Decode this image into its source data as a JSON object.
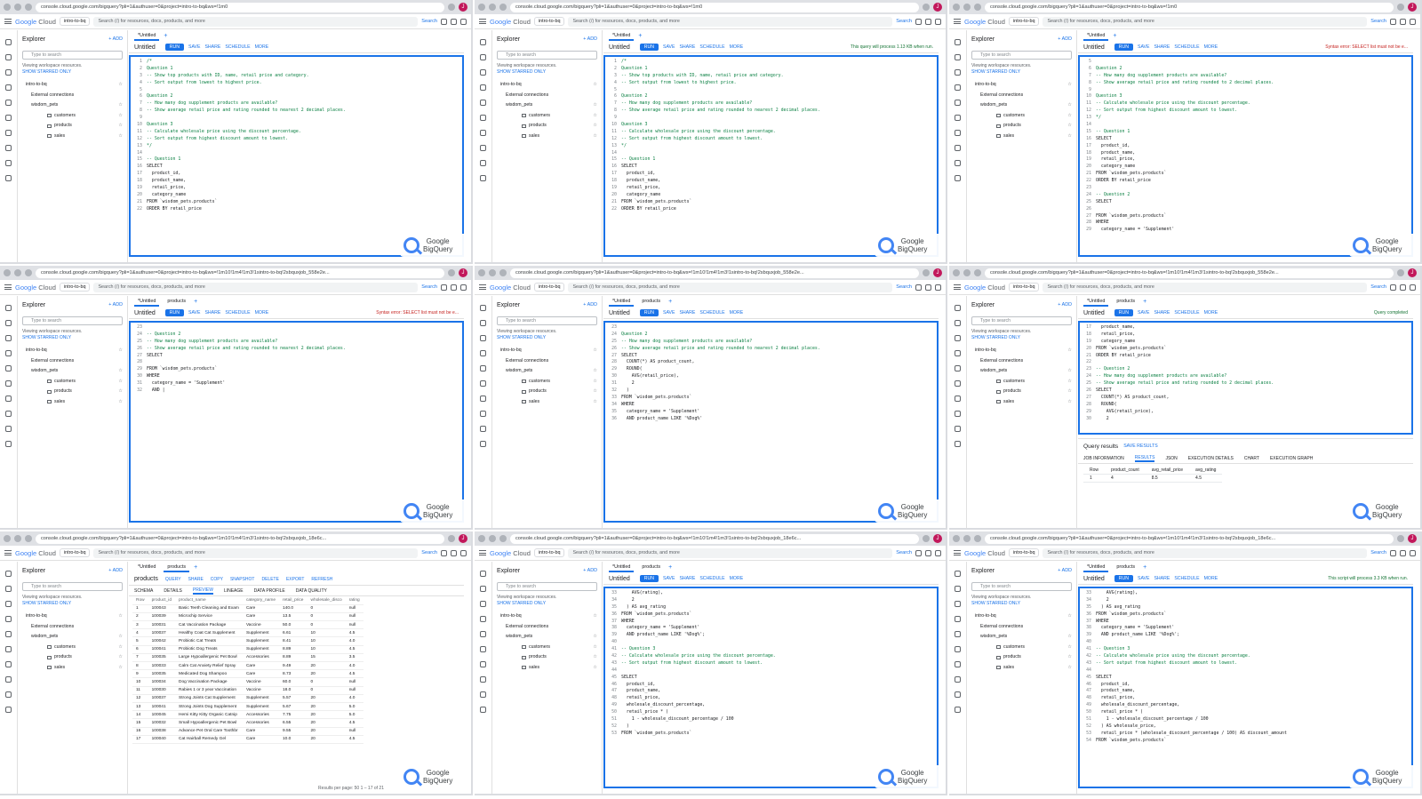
{
  "browser": {
    "url_top": "console.cloud.google.com/bigquery?pli=1&authuser=0&project=intro-to-bq&ws=!1m0",
    "url_mid": "console.cloud.google.com/bigquery?pli=1&authuser=0&project=intro-to-bq&ws=!1m10!1m4!1m3!1sintro-to-bq!2sbquxjob_558e2e...",
    "url_bot": "console.cloud.google.com/bigquery?pli=1&authuser=0&project=intro-to-bq&ws=!1m10!1m4!1m3!1sintro-to-bq!2sbquxjob_18e6c...",
    "avatar": "J"
  },
  "gcp": {
    "logo_google": "Google",
    "logo_cloud": " Cloud",
    "project": "intro-to-bq",
    "search_placeholder": "Search (/) for resources, docs, products, and more",
    "search_button": "Search"
  },
  "explorer": {
    "title": "Explorer",
    "add": "+ ADD",
    "filter_placeholder": "Type to search",
    "note_1": "Viewing workspace resources.",
    "note_2": "SHOW STARRED ONLY",
    "tree": [
      "intro-to-bq",
      "External connections",
      "wisdom_pets",
      "customers",
      "products",
      "sales"
    ]
  },
  "workspace": {
    "tab_untitled": "*Untitled",
    "tab_products": "products",
    "title": "Untitled",
    "run": "RUN",
    "save": "SAVE",
    "share": "SHARE",
    "schedule": "SCHEDULE",
    "more": "MORE",
    "status_ok": "This query will process 1.13 KB when run.",
    "status_err": "Syntax error: SELECT list must not be e...",
    "status_done": "Query completed",
    "status_script": "This script will process 3.3 KB when run.",
    "results_label": "Query results",
    "save_results": "SAVE RESULTS"
  },
  "watermark": {
    "line1": "Google",
    "line2": "BigQuery"
  },
  "code_a": [
    "/*",
    "Question 1",
    "-- Show top products with ID, name, retail price and category.",
    "-- Sort output from lowest to highest price.",
    "",
    "Question 2",
    "-- How many dog supplement products are available?",
    "-- Show average retail price and rating rounded to nearest 2 decimal places.",
    "",
    "Question 3",
    "-- Calculate wholesale price using the discount percentage.",
    "-- Sort output from highest discount amount to lowest.",
    "*/",
    "",
    "-- Question 1",
    "SELECT",
    "  product_id,",
    "  product_name,",
    "  retail_price,",
    "  category_name",
    "FROM `wisdom_pets.products`",
    "ORDER BY retail_price"
  ],
  "code_c": [
    "",
    "Question 2",
    "-- How many dog supplement products are available?",
    "-- Show average retail price and rating rounded to 2 decimal places.",
    "",
    "Question 3",
    "-- Calculate wholesale price using the discount percentage.",
    "-- Sort output from highest discount amount to lowest.",
    "*/",
    "",
    "-- Question 1",
    "SELECT",
    "  product_id,",
    "  product_name,",
    "  retail_price,",
    "  category_name",
    "FROM `wisdom_pets.products`",
    "ORDER BY retail_price",
    "",
    "-- Question 2",
    "SELECT",
    "",
    "FROM `wisdom_pets.products`",
    "WHERE",
    "  category_name = 'Supplement'"
  ],
  "code_d": [
    "",
    "-- Question 2",
    "-- How many dog supplement products are available?",
    "-- Show average retail price and rating rounded to nearest 2 decimal places.",
    "SELECT",
    "",
    "FROM `wisdom_pets.products`",
    "WHERE",
    "  category_name = 'Supplement'",
    "  AND |"
  ],
  "code_e": [
    "",
    "Question 2",
    "-- How many dog supplement products are available?",
    "-- Show average retail price and rating rounded to nearest 2 decimal places.",
    "SELECT",
    "  COUNT(*) AS product_count,",
    "  ROUND(",
    "    AVG(retail_price),",
    "    2",
    "  )",
    "FROM `wisdom_pets.products`",
    "WHERE",
    "  category_name = 'Supplement'",
    "  AND product_name LIKE '%Dog%'"
  ],
  "code_f": [
    "  product_name,",
    "  retail_price,",
    "  category_name",
    "FROM `wisdom_pets.products`",
    "ORDER BY retail_price",
    "",
    "-- Question 2",
    "-- How many dog supplement products are available?",
    "-- Show average retail price and rating rounded to 2 decimal places.",
    "SELECT",
    "  COUNT(*) AS product_count,",
    "  ROUND(",
    "    AVG(retail_price),",
    "    2"
  ],
  "code_h": [
    "    AVG(rating),",
    "    2",
    "  ) AS avg_rating",
    "FROM `wisdom_pets.products`",
    "WHERE",
    "  category_name = 'Supplement'",
    "  AND product_name LIKE '%Dog%';",
    "",
    "-- Question 3",
    "-- Calculate wholesale price using the discount percentage.",
    "-- Sort output from highest discount amount to lowest.",
    "",
    "SELECT",
    "  product_id,",
    "  product_name,",
    "  retail_price,",
    "  wholesale_discount_percentage,",
    "  retail_price * (",
    "    1 - wholesale_discount_percentage / 100",
    "  )",
    "FROM `wisdom_pets.products`"
  ],
  "code_i": [
    "    AVG(rating),",
    "    2",
    "  ) AS avg_rating",
    "FROM `wisdom_pets.products`",
    "WHERE",
    "  category_name = 'Supplement'",
    "  AND product_name LIKE '%Dog%';",
    "",
    "-- Question 3",
    "-- Calculate wholesale price using the discount percentage.",
    "-- Sort output from highest discount amount to lowest.",
    "",
    "SELECT",
    "  product_id,",
    "  product_name,",
    "  retail_price,",
    "  wholesale_discount_percentage,",
    "  retail_price * (",
    "    1 - wholesale_discount_percentage / 100",
    "  ) AS wholesale_price,",
    "  retail_price * (wholesale_discount_percentage / 100) AS discount_amount",
    "FROM `wisdom_pets.products`"
  ],
  "results": {
    "tabs": [
      "JOB INFORMATION",
      "RESULTS",
      "JSON",
      "EXECUTION DETAILS",
      "CHART",
      "EXECUTION GRAPH"
    ],
    "headers": [
      "Row",
      "product_count",
      "avg_retail_price",
      "avg_rating"
    ],
    "row": [
      "1",
      "4",
      "8.5",
      "4.5"
    ]
  },
  "preview": {
    "title": "products",
    "actions": [
      "QUERY",
      "SHARE",
      "COPY",
      "SNAPSHOT",
      "DELETE",
      "EXPORT",
      "REFRESH"
    ],
    "tabs": [
      "SCHEMA",
      "DETAILS",
      "PREVIEW",
      "LINEAGE",
      "DATA PROFILE",
      "DATA QUALITY"
    ],
    "headers": [
      "Row",
      "product_id",
      "product_name",
      "category_name",
      "retail_price",
      "wholesale_disco",
      "rating"
    ],
    "rows": [
      [
        "1",
        "100043",
        "Basic Teeth Cleaning and Exam",
        "Care",
        "140.0",
        "0",
        "null"
      ],
      [
        "2",
        "100039",
        "Microchip Service",
        "Care",
        "13.5",
        "0",
        "null"
      ],
      [
        "3",
        "100031",
        "Cat Vaccination Package",
        "Vaccine",
        "50.0",
        "0",
        "null"
      ],
      [
        "4",
        "100037",
        "Healthy Coat Cat Supplement",
        "Supplement",
        "6.61",
        "10",
        "4.5"
      ],
      [
        "5",
        "100042",
        "Probiotic Cat Treats",
        "Supplement",
        "8.41",
        "10",
        "4.0"
      ],
      [
        "6",
        "100041",
        "Probiotic Dog Treats",
        "Supplement",
        "8.89",
        "10",
        "4.5"
      ],
      [
        "7",
        "100035",
        "Large Hypoallergenic Pet Bowl",
        "Accessories",
        "8.89",
        "15",
        "3.5"
      ],
      [
        "8",
        "100033",
        "Calm Cat Anxiety Relief Spray",
        "Care",
        "9.49",
        "20",
        "4.0"
      ],
      [
        "9",
        "100035",
        "Medicated Dog Shampoo",
        "Care",
        "8.73",
        "20",
        "4.5"
      ],
      [
        "10",
        "100034",
        "Dog Vaccination Package",
        "Vaccine",
        "60.0",
        "0",
        "null"
      ],
      [
        "11",
        "100030",
        "Rabies 1 or 3 year Vaccination",
        "Vaccine",
        "18.0",
        "0",
        "null"
      ],
      [
        "12",
        "100037",
        "Strong Joints Cat Supplement",
        "Supplement",
        "5.57",
        "20",
        "4.0"
      ],
      [
        "13",
        "100041",
        "Strong Joints Dog Supplement",
        "Supplement",
        "5.67",
        "20",
        "5.0"
      ],
      [
        "14",
        "100045",
        "Hemi Kitty Kitty Organic Catnip",
        "Accessories",
        "7.75",
        "20",
        "5.0"
      ],
      [
        "15",
        "100032",
        "Small Hypoallergenic Pet Bowl",
        "Accessories",
        "6.55",
        "20",
        "4.5"
      ],
      [
        "16",
        "100038",
        "Advance Pet Oral Care Toothbr",
        "Care",
        "9.55",
        "20",
        "null"
      ],
      [
        "17",
        "100040",
        "Cat Hairball Remedy Gel",
        "Care",
        "10.0",
        "20",
        "4.5"
      ]
    ],
    "pager": "Results per page: 50  1 – 17 of 21"
  }
}
